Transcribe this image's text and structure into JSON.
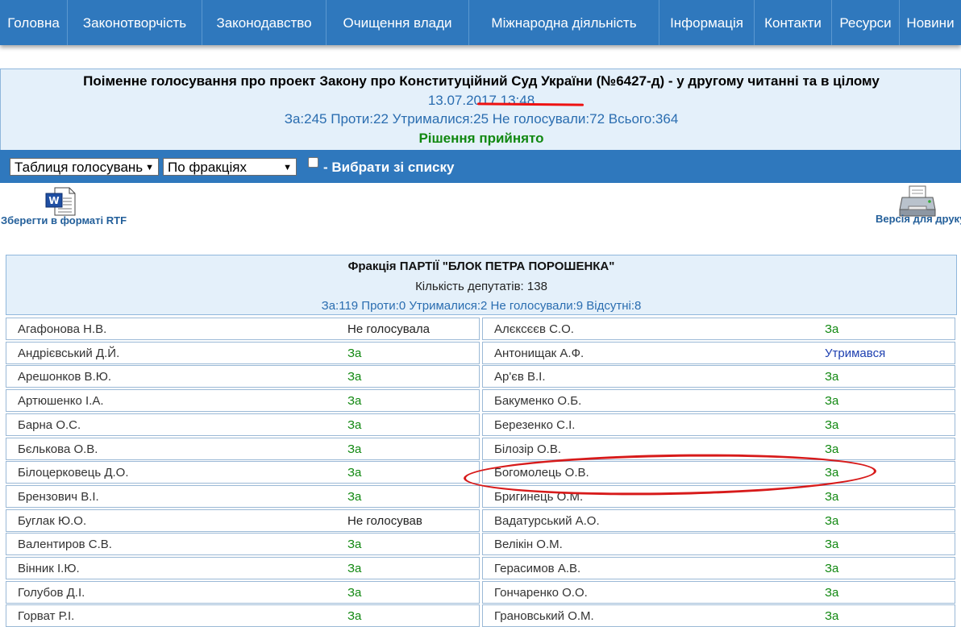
{
  "nav": [
    {
      "label": "Головна"
    },
    {
      "label": "Законотворчість"
    },
    {
      "label": "Законодавство"
    },
    {
      "label": "Очищення влади"
    },
    {
      "label": "Міжнародна діяльність"
    },
    {
      "label": "Інформація"
    },
    {
      "label": "Контакти"
    },
    {
      "label": "Ресурси"
    },
    {
      "label": "Новини"
    }
  ],
  "vote": {
    "title": "Поіменне голосування про проект Закону про Конституційний Суд України (№6427-д) - у другому читанні та в цілому",
    "datetime": "13.07.2017 13:48",
    "totals": "За:245 Проти:22 Утрималися:25 Не голосували:72 Всього:364",
    "decision": "Рішення прийнято"
  },
  "toolbar": {
    "view_select": "Таблиця голосувань",
    "group_select": "По фракціях",
    "choose_label": "- Вибрати зі списку"
  },
  "actions": {
    "rtf_label": "Зберегти в форматі RTF",
    "print_label": "Версія для друку"
  },
  "faction": {
    "title": "Фракція ПАРТІЇ \"БЛОК ПЕТРА ПОРОШЕНКА\"",
    "count": "Кількість депутатів: 138",
    "stats": "За:119 Проти:0 Утрималися:2 Не голосували:9 Відсутні:8"
  },
  "rows": [
    {
      "left": {
        "name": "Агафонова Н.В.",
        "vote": "Не голосувала",
        "kind": "nv"
      },
      "right": {
        "name": "Алєксєєв С.О.",
        "vote": "За",
        "kind": "za"
      }
    },
    {
      "left": {
        "name": "Андрієвський Д.Й.",
        "vote": "За",
        "kind": "za"
      },
      "right": {
        "name": "Антонищак А.Ф.",
        "vote": "Утримався",
        "kind": "ab"
      }
    },
    {
      "left": {
        "name": "Арешонков В.Ю.",
        "vote": "За",
        "kind": "za"
      },
      "right": {
        "name": "Ар'єв В.І.",
        "vote": "За",
        "kind": "za"
      }
    },
    {
      "left": {
        "name": "Артюшенко І.А.",
        "vote": "За",
        "kind": "za"
      },
      "right": {
        "name": "Бакуменко О.Б.",
        "vote": "За",
        "kind": "za"
      }
    },
    {
      "left": {
        "name": "Барна О.С.",
        "vote": "За",
        "kind": "za"
      },
      "right": {
        "name": "Березенко С.І.",
        "vote": "За",
        "kind": "za"
      }
    },
    {
      "left": {
        "name": "Бєлькова О.В.",
        "vote": "За",
        "kind": "za"
      },
      "right": {
        "name": "Білозір О.В.",
        "vote": "За",
        "kind": "za"
      }
    },
    {
      "left": {
        "name": "Білоцерковець Д.О.",
        "vote": "За",
        "kind": "za"
      },
      "right": {
        "name": "Богомолець О.В.",
        "vote": "За",
        "kind": "za"
      }
    },
    {
      "left": {
        "name": "Брензович В.І.",
        "vote": "За",
        "kind": "za"
      },
      "right": {
        "name": "Бригинець О.М.",
        "vote": "За",
        "kind": "za"
      }
    },
    {
      "left": {
        "name": "Буглак Ю.О.",
        "vote": "Не голосував",
        "kind": "nv"
      },
      "right": {
        "name": "Вадатурський А.О.",
        "vote": "За",
        "kind": "za"
      }
    },
    {
      "left": {
        "name": "Валентиров С.В.",
        "vote": "За",
        "kind": "za"
      },
      "right": {
        "name": "Велікін О.М.",
        "vote": "За",
        "kind": "za"
      }
    },
    {
      "left": {
        "name": "Вінник І.Ю.",
        "vote": "За",
        "kind": "za"
      },
      "right": {
        "name": "Герасимов А.В.",
        "vote": "За",
        "kind": "za"
      }
    },
    {
      "left": {
        "name": "Голубов Д.І.",
        "vote": "За",
        "kind": "za"
      },
      "right": {
        "name": "Гончаренко О.О.",
        "vote": "За",
        "kind": "za"
      }
    },
    {
      "left": {
        "name": "Горват Р.І.",
        "vote": "За",
        "kind": "za"
      },
      "right": {
        "name": "Грановський О.М.",
        "vote": "За",
        "kind": "za"
      }
    }
  ],
  "colors": {
    "nav_bg": "#2f78bd",
    "panel_bg": "#e4f0fa",
    "vote_for": "#118811",
    "vote_abstain": "#1d3fb0",
    "highlight": "#d71a1a"
  }
}
